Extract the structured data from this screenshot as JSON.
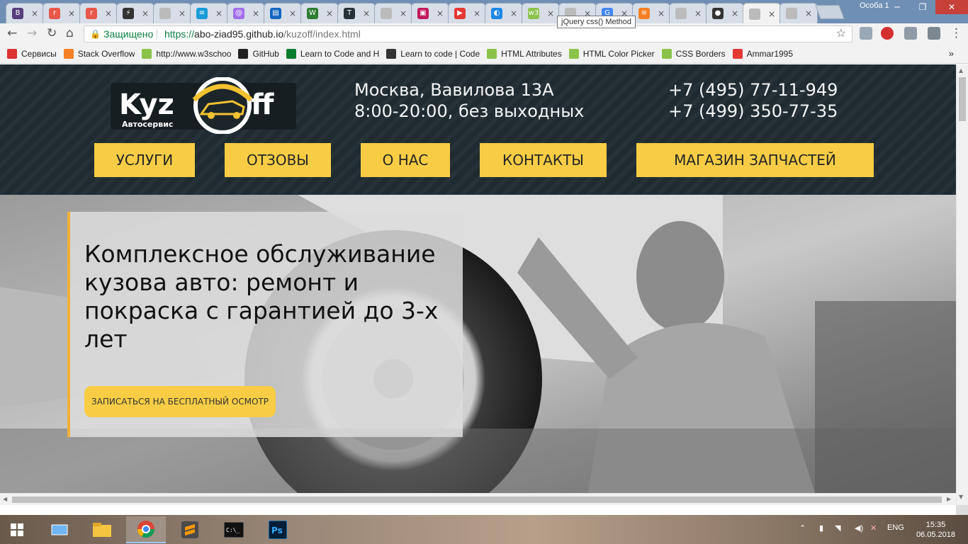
{
  "browser": {
    "tabs": [
      {
        "title": "",
        "color": "#563d7c",
        "glyph": "B"
      },
      {
        "title": "",
        "color": "#e8584a",
        "glyph": "r"
      },
      {
        "title": "",
        "color": "#e8584a",
        "glyph": "r"
      },
      {
        "title": "",
        "color": "#333333",
        "glyph": "⚡"
      },
      {
        "title": "",
        "color": "#bbbbbb",
        "glyph": ""
      },
      {
        "title": "",
        "color": "#1a9bd7",
        "glyph": "≡"
      },
      {
        "title": "",
        "color": "#a36fe8",
        "glyph": "@"
      },
      {
        "title": "",
        "color": "#1565c0",
        "glyph": "▤"
      },
      {
        "title": "",
        "color": "#2e7d32",
        "glyph": "W"
      },
      {
        "title": "",
        "color": "#263238",
        "glyph": "T"
      },
      {
        "title": "",
        "color": "#bbbbbb",
        "glyph": ""
      },
      {
        "title": "",
        "color": "#c2185b",
        "glyph": "▣"
      },
      {
        "title": "",
        "color": "#e53935",
        "glyph": "▶"
      },
      {
        "title": "",
        "color": "#1e88e5",
        "glyph": "◐"
      },
      {
        "title": "",
        "color": "#8bc34a",
        "glyph": "w3"
      },
      {
        "title": "",
        "color": "#bbbbbb",
        "glyph": ""
      },
      {
        "title": "",
        "color": "#4285f4",
        "glyph": "G"
      },
      {
        "title": "",
        "color": "#f48024",
        "glyph": "≋"
      },
      {
        "title": "",
        "color": "#bbbbbb",
        "glyph": ""
      },
      {
        "title": "",
        "color": "#333333",
        "glyph": "●"
      },
      {
        "title": "",
        "color": "#bbbbbb",
        "glyph": ""
      },
      {
        "title": "",
        "color": "#bbbbbb",
        "glyph": ""
      }
    ],
    "profile_name": "Особа 1",
    "secure_label": "Защищено",
    "url_scheme": "https://",
    "url_host": "abo-ziad95.github.io",
    "url_path": "/kuzoff/index.html",
    "tooltip": "jQuery css() Method",
    "bookmarks": [
      {
        "label": "Сервисы",
        "color": "#d33"
      },
      {
        "label": "Stack Overflow",
        "color": "#f48024"
      },
      {
        "label": "http://www.w3schoo",
        "color": "#8bc34a"
      },
      {
        "label": "GitHub",
        "color": "#222"
      },
      {
        "label": "Learn to Code and H",
        "color": "#0a7d2e"
      },
      {
        "label": "Learn to code | Code",
        "color": "#333"
      },
      {
        "label": "HTML Attributes",
        "color": "#8bc34a"
      },
      {
        "label": "HTML Color Picker",
        "color": "#8bc34a"
      },
      {
        "label": "CSS Borders",
        "color": "#8bc34a"
      },
      {
        "label": "Ammar1995",
        "color": "#e53935"
      }
    ]
  },
  "site": {
    "logo_main_left": "Kyz",
    "logo_main_right": "ff",
    "logo_sub": "Автосервис",
    "address": "Москва, Вавилова 13А",
    "hours": "8:00-20:00, без выходных",
    "phone1": "+7 (495) 77-11-949",
    "phone2": "+7 (499) 350-77-35",
    "menu": [
      "УСЛУГИ",
      "ОТЗОВЫ",
      "О НАС",
      "КОНТАКТЫ",
      "МАГАЗИН ЗАПЧАСТЕЙ"
    ],
    "hero_title": "Комплексное обслуживание кузова авто: ремонт и покраска с гарантией до 3-х лет",
    "hero_button": "ЗАПИСАТЬСЯ НА БЕСПЛАТНЫЙ ОСМОТР",
    "accent_color": "#f8cd45"
  },
  "taskbar": {
    "apps": [
      "windows-explorer",
      "file-manager",
      "chrome",
      "sublime-text",
      "command-prompt",
      "photoshop"
    ],
    "lang": "ENG",
    "time": "15:35",
    "date": "06.05.2018"
  }
}
